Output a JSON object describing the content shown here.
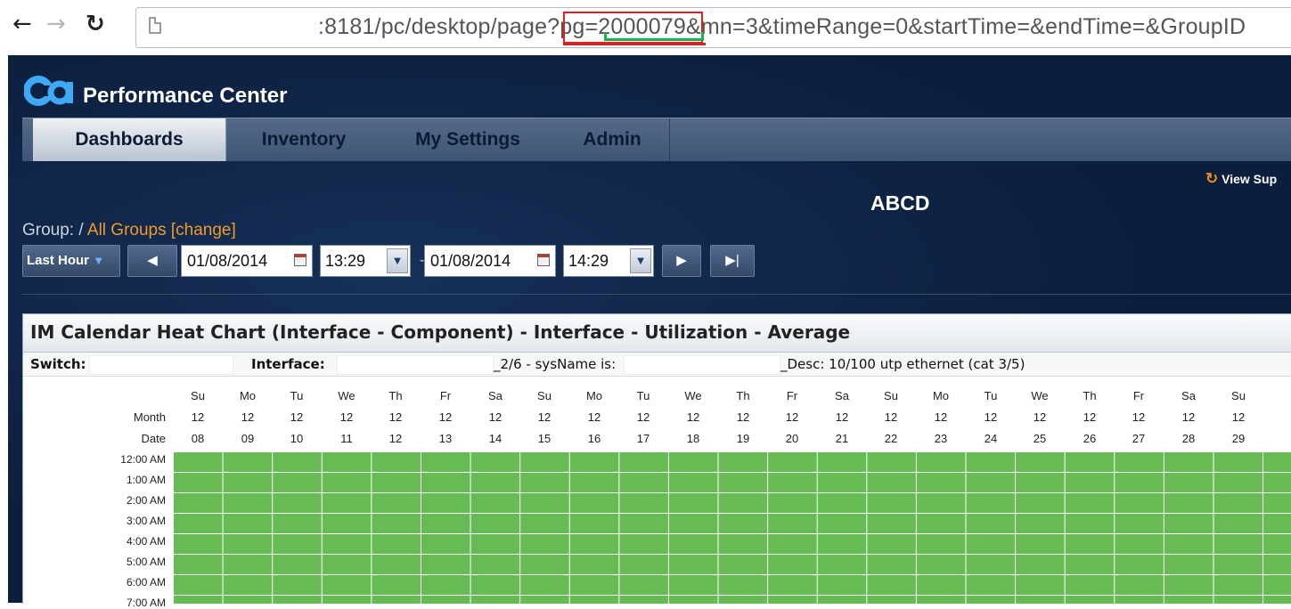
{
  "browser": {
    "url": ":8181/pc/desktop/page?pg=2000079&mn=3&timeRange=0&startTime=&endTime=&GroupID",
    "back_icon": "back-arrow-icon",
    "forward_icon": "forward-arrow-icon",
    "reload_icon": "reload-icon",
    "page_icon": "page-icon",
    "annotation_colors": {
      "red_box": "#e02020",
      "green_bracket": "#18b050"
    }
  },
  "app": {
    "title": "Performance Center",
    "logo_text": "ca",
    "nav": [
      "Dashboards",
      "Inventory",
      "My Settings",
      "Admin"
    ],
    "active_nav": "Dashboards",
    "view_link": "View Sup",
    "page_title": "ABCD",
    "group": {
      "label": "Group: /",
      "value": "All Groups",
      "change": "[change]"
    },
    "time": {
      "range": "Last Hour",
      "start_date": "01/08/2014",
      "start_time": "13:29",
      "end_date": "01/08/2014",
      "end_time": "14:29"
    },
    "colors": {
      "background": "#0b1e3d",
      "accent": "#f09a2a",
      "cell": "#66bb55"
    }
  },
  "chart": {
    "title": "IM Calendar Heat Chart (Interface - Component) - Interface - Utilization - Average",
    "info": {
      "switch_label": "Switch:",
      "interface_label": "Interface:",
      "sysname_text": "_2/6 - sysName is:",
      "desc_text": "_Desc: 10/100 utp ethernet (cat 3/5)"
    },
    "row_labels": {
      "month": "Month",
      "date": "Date"
    },
    "columns": [
      {
        "day": "Su",
        "month": "12",
        "date": "08"
      },
      {
        "day": "Mo",
        "month": "12",
        "date": "09"
      },
      {
        "day": "Tu",
        "month": "12",
        "date": "10"
      },
      {
        "day": "We",
        "month": "12",
        "date": "11"
      },
      {
        "day": "Th",
        "month": "12",
        "date": "12"
      },
      {
        "day": "Fr",
        "month": "12",
        "date": "13"
      },
      {
        "day": "Sa",
        "month": "12",
        "date": "14"
      },
      {
        "day": "Su",
        "month": "12",
        "date": "15"
      },
      {
        "day": "Mo",
        "month": "12",
        "date": "16"
      },
      {
        "day": "Tu",
        "month": "12",
        "date": "17"
      },
      {
        "day": "We",
        "month": "12",
        "date": "18"
      },
      {
        "day": "Th",
        "month": "12",
        "date": "19"
      },
      {
        "day": "Fr",
        "month": "12",
        "date": "20"
      },
      {
        "day": "Sa",
        "month": "12",
        "date": "21"
      },
      {
        "day": "Su",
        "month": "12",
        "date": "22"
      },
      {
        "day": "Mo",
        "month": "12",
        "date": "23"
      },
      {
        "day": "Tu",
        "month": "12",
        "date": "24"
      },
      {
        "day": "We",
        "month": "12",
        "date": "25"
      },
      {
        "day": "Th",
        "month": "12",
        "date": "26"
      },
      {
        "day": "Fr",
        "month": "12",
        "date": "27"
      },
      {
        "day": "Sa",
        "month": "12",
        "date": "28"
      },
      {
        "day": "Su",
        "month": "12",
        "date": "29"
      }
    ],
    "hours": [
      "12:00 AM",
      "1:00 AM",
      "2:00 AM",
      "3:00 AM",
      "4:00 AM",
      "5:00 AM",
      "6:00 AM",
      "7:00 AM"
    ]
  }
}
